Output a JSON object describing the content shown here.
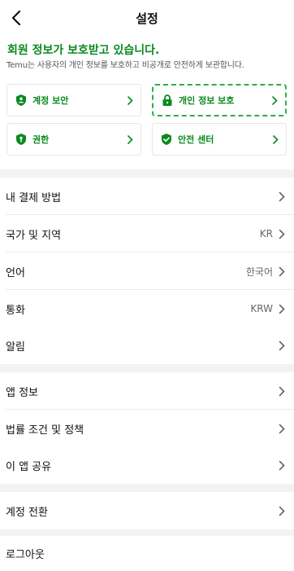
{
  "header": {
    "title": "설정"
  },
  "privacy": {
    "title": "회원 정보가 보호받고 있습니다.",
    "description": "Temu는 사용자의 개인 정보를 보호하고 비공개로 안전하게 보관합니다."
  },
  "cards": [
    {
      "label": "계정 보안",
      "icon": "account-lock-icon"
    },
    {
      "label": "개인 정보 보호",
      "icon": "padlock-icon"
    },
    {
      "label": "권한",
      "icon": "shield-key-icon"
    },
    {
      "label": "안전 센터",
      "icon": "shield-check-icon"
    }
  ],
  "menu": {
    "payment": {
      "label": "내 결제 방법"
    },
    "region": {
      "label": "국가 및 지역",
      "value": "KR"
    },
    "language": {
      "label": "언어",
      "value": "한국어"
    },
    "currency": {
      "label": "통화",
      "value": "KRW"
    },
    "notifications": {
      "label": "알림"
    },
    "about": {
      "label": "앱 정보"
    },
    "legal": {
      "label": "법률 조건 및 정책"
    },
    "share": {
      "label": "이 앱 공유"
    },
    "switch_account": {
      "label": "계정 전환"
    },
    "logout": {
      "label": "로그아웃"
    }
  },
  "colors": {
    "accent": "#0a8a1f",
    "highlight_border": "#2bb04a",
    "divider": "#f3f3f3"
  }
}
